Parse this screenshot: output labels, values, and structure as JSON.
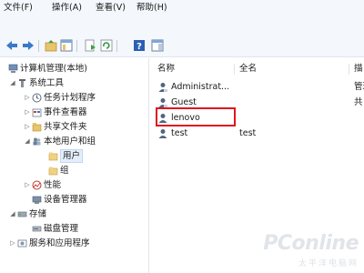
{
  "menu": {
    "file": "文件(F)",
    "action": "操作(A)",
    "view": "查看(V)",
    "help": "帮助(H)"
  },
  "toolbar": {
    "buttons": [
      "back-icon",
      "forward-icon",
      "up-folder-icon",
      "show-hide-tree-icon",
      "export-list-icon",
      "refresh-icon",
      "properties-icon",
      "help-icon",
      "action-pane-icon"
    ]
  },
  "tree": {
    "root": "计算机管理(本地)",
    "system_tools": "系统工具",
    "task_scheduler": "任务计划程序",
    "event_viewer": "事件查看器",
    "shared_folders": "共享文件夹",
    "local_users_groups": "本地用户和组",
    "users": "用户",
    "groups": "组",
    "performance": "性能",
    "device_manager": "设备管理器",
    "storage": "存储",
    "disk_management": "磁盘管理",
    "services_apps": "服务和应用程序"
  },
  "list": {
    "col_name": "名称",
    "col_fullname": "全名",
    "col_desc": "描",
    "rows": [
      {
        "name": "Administrat...",
        "fullname": "",
        "desc": "管理"
      },
      {
        "name": "Guest",
        "fullname": "",
        "desc": "共"
      },
      {
        "name": "lenovo",
        "fullname": "",
        "desc": ""
      },
      {
        "name": "test",
        "fullname": "test",
        "desc": ""
      }
    ]
  },
  "watermark": {
    "logo": "PConline",
    "sub": "太平洋电脑网"
  },
  "colors": {
    "highlight": "#e0141e",
    "selection": "#e4eefb"
  }
}
